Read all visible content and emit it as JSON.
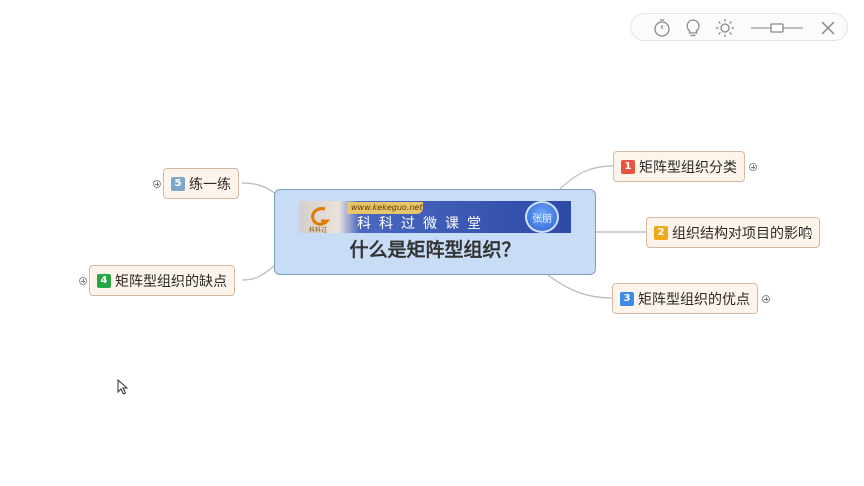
{
  "toolbar": {
    "icons": [
      "timer-icon",
      "lightbulb-icon",
      "brightness-icon",
      "zoom-slider",
      "close-icon"
    ]
  },
  "central_topic": {
    "banner_url": "www.kekeguo.net",
    "banner_logo_text": "科科过",
    "banner_title": "科科过微课堂",
    "banner_name": "张朋",
    "title": "什么是矩阵型组织？"
  },
  "topics": [
    {
      "number": "1",
      "label": "矩阵型组织分类",
      "badge_color": "#e8543f"
    },
    {
      "number": "2",
      "label": "组织结构对项目的影响",
      "badge_color": "#f0a81d"
    },
    {
      "number": "3",
      "label": "矩阵型组织的优点",
      "badge_color": "#3d8be8"
    },
    {
      "number": "4",
      "label": "矩阵型组织的缺点",
      "badge_color": "#28a745"
    },
    {
      "number": "5",
      "label": "练一练",
      "badge_color": "#7ca7c8"
    }
  ],
  "colors": {
    "central_fill": "#c9dcf6",
    "topic_fill": "#fdf4ec",
    "connector": "#b7b7b7"
  }
}
